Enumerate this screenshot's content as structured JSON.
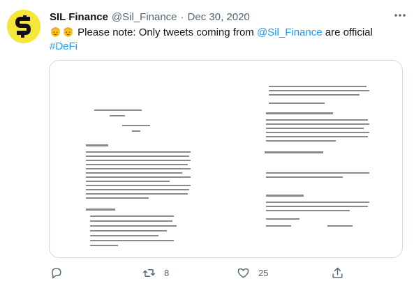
{
  "tweet": {
    "author_name": "SIL Finance",
    "handle": "@Sil_Finance",
    "separator": "·",
    "date": "Dec 30, 2020",
    "text_prefix": "Please note: Only tweets coming from ",
    "mention": "@Sil_Finance",
    "text_suffix": " are official",
    "hashtag": "#DeFi"
  },
  "actions": {
    "reply_count": "",
    "retweet_count": "8",
    "like_count": "25"
  },
  "icons": [
    "more-icon",
    "reply-icon",
    "retweet-icon",
    "like-icon",
    "share-icon"
  ],
  "colors": {
    "link": "#1d9bf0",
    "avatar_bg": "#f7e63a",
    "muted": "#536471"
  }
}
